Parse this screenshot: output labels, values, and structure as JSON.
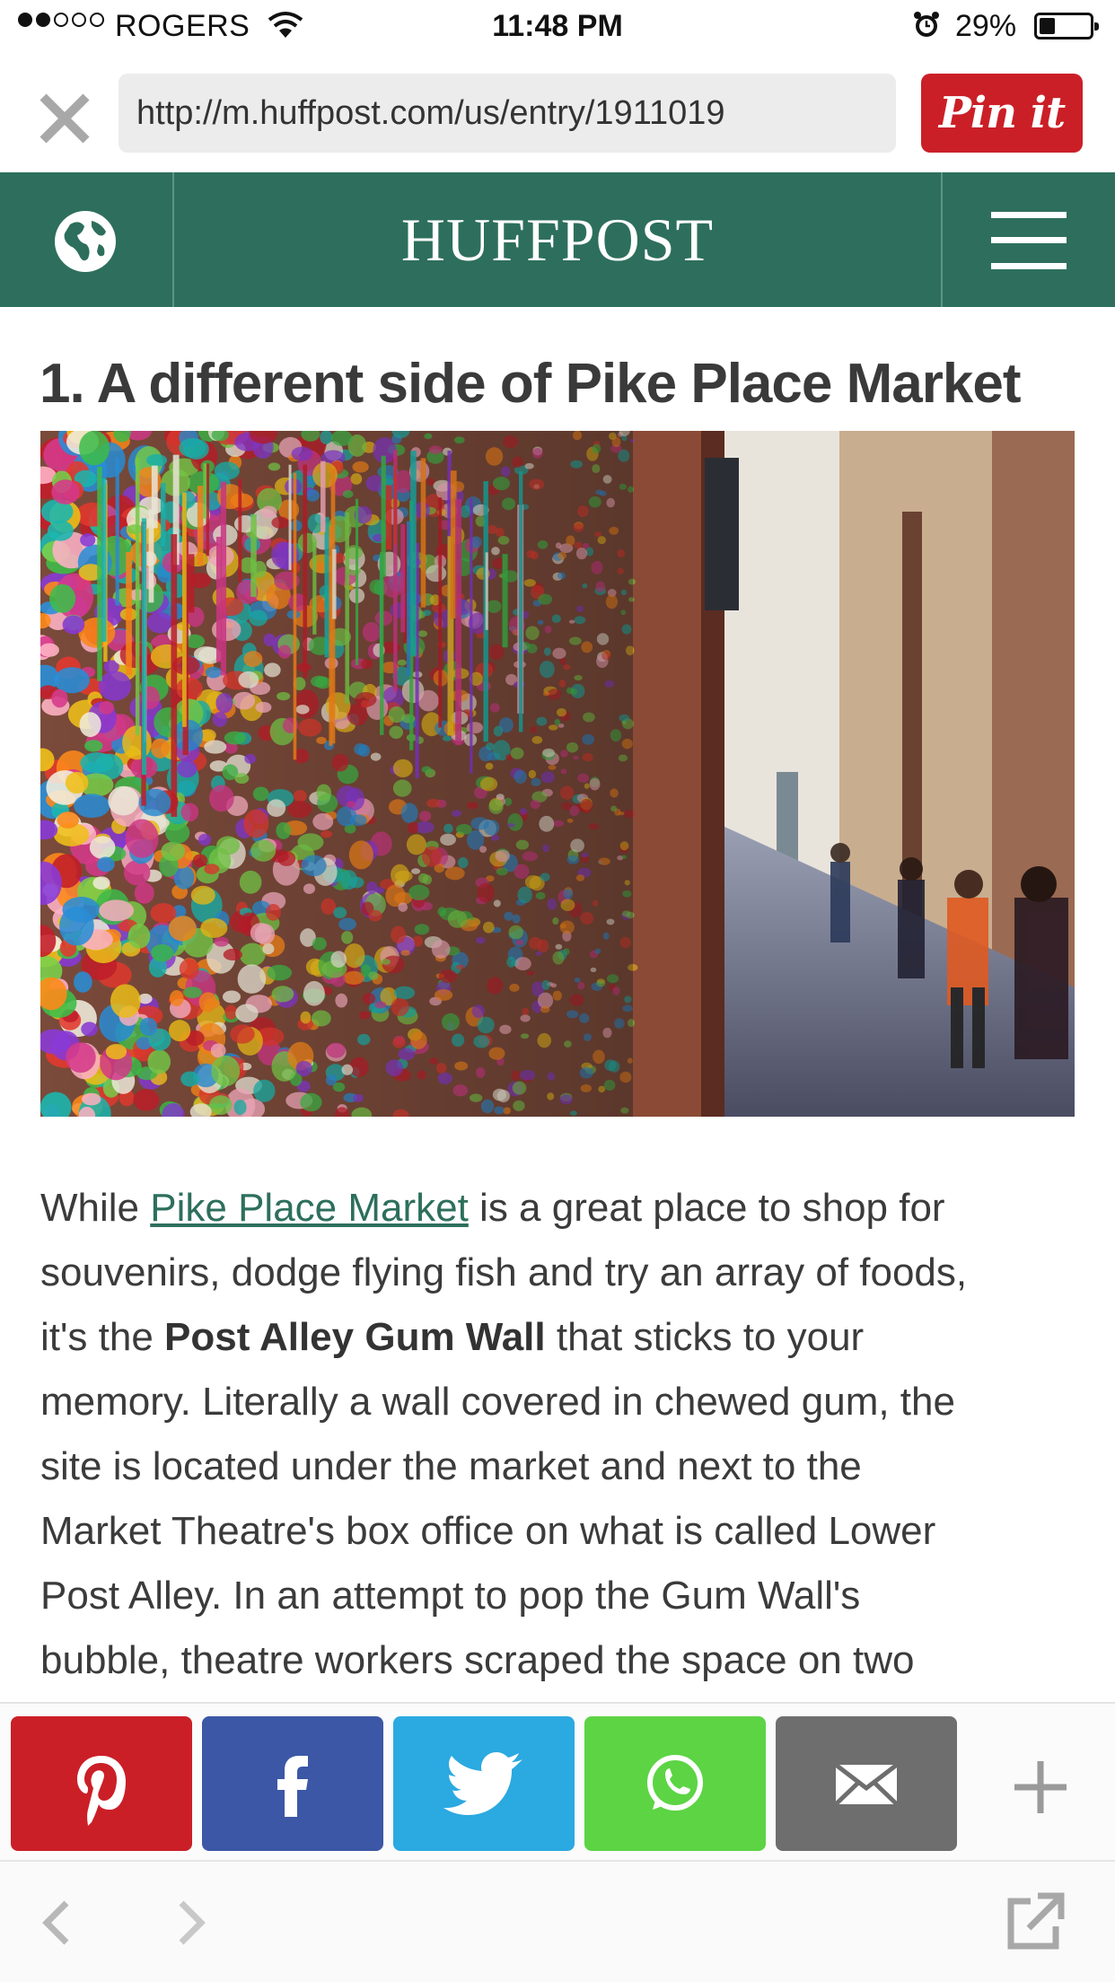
{
  "status_bar": {
    "carrier": "ROGERS",
    "time": "11:48 PM",
    "battery": "29%",
    "signal_strength": 2,
    "battery_level": 0.29
  },
  "browser": {
    "url": "http://m.huffpost.com/us/entry/1911019",
    "pin_label": "Pin it"
  },
  "header": {
    "logo": "HUFFPOST",
    "brand_color": "#2d6f5c"
  },
  "article": {
    "headline": "1. A different side of Pike Place Market",
    "paragraph": {
      "l1_pre": "While ",
      "l1_link": "Pike Place Market",
      "l1_post": " is a great place to shop for",
      "l2": "souvenirs, dodge flying fish and try an array of foods,",
      "l3_pre": "it's the ",
      "l3_bold": "Post Alley Gum Wall",
      "l3_post": " that sticks to your",
      "l4": "memory. Literally a wall covered in chewed gum, the",
      "l5": "site is located under the market and next to the",
      "l6": "Market Theatre's box office on what is called Lower",
      "l7": "Post Alley. In an attempt to pop the Gum Wall's",
      "l8": "bubble, theatre workers scraped the space on two"
    }
  },
  "share_bar": {
    "buttons": [
      {
        "name": "pinterest",
        "color": "#cb1f27"
      },
      {
        "name": "facebook",
        "color": "#3b57a6"
      },
      {
        "name": "twitter",
        "color": "#2ba9e1"
      },
      {
        "name": "whatsapp",
        "color": "#5cd444"
      },
      {
        "name": "email",
        "color": "#6e6e6e"
      }
    ]
  }
}
